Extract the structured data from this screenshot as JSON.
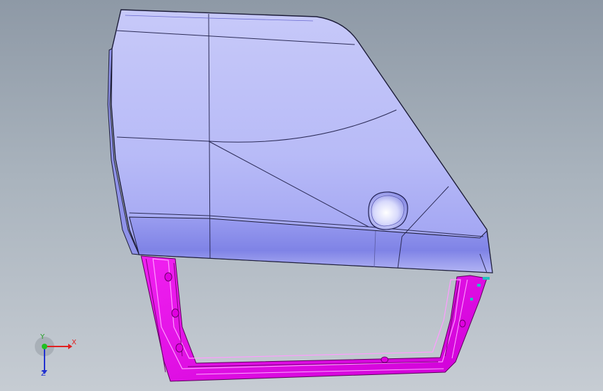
{
  "viewport": {
    "background_top": "#8e99a6",
    "background_bottom": "#c6ccd3"
  },
  "model": {
    "panel_color": "#bcbef8",
    "panel_shade": "#7b7ee6",
    "frame_color": "#e600e6",
    "edge_color": "#202040"
  },
  "triad": {
    "x_label": "X",
    "y_label": "Y",
    "z_label": "Z",
    "x_color": "#e02020",
    "y_color": "#20c020",
    "z_color": "#2030d0"
  }
}
